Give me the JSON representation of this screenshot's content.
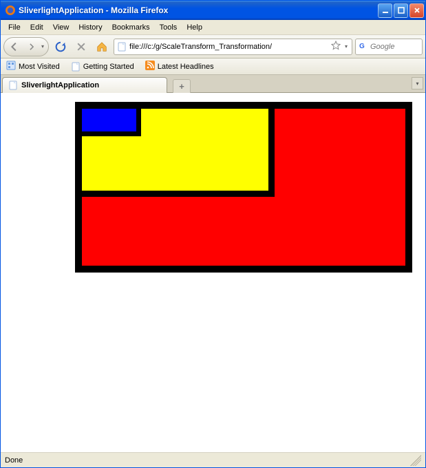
{
  "window": {
    "title": "SliverlightApplication - Mozilla Firefox"
  },
  "menu": {
    "file": "File",
    "edit": "Edit",
    "view": "View",
    "history": "History",
    "bookmarks": "Bookmarks",
    "tools": "Tools",
    "help": "Help"
  },
  "toolbar": {
    "url": "file:///c:/g/ScaleTransform_Transformation/",
    "search_placeholder": "Google"
  },
  "bookmarks": {
    "most_visited": "Most Visited",
    "getting_started": "Getting Started",
    "latest_headlines": "Latest Headlines"
  },
  "tabs": {
    "active": "SliverlightApplication",
    "newtab": "+"
  },
  "content": {
    "colors": {
      "canvas_bg": "#000000",
      "red": "#ff0000",
      "yellow": "#ffff00",
      "blue": "#0000ff"
    }
  },
  "status": {
    "text": "Done"
  }
}
